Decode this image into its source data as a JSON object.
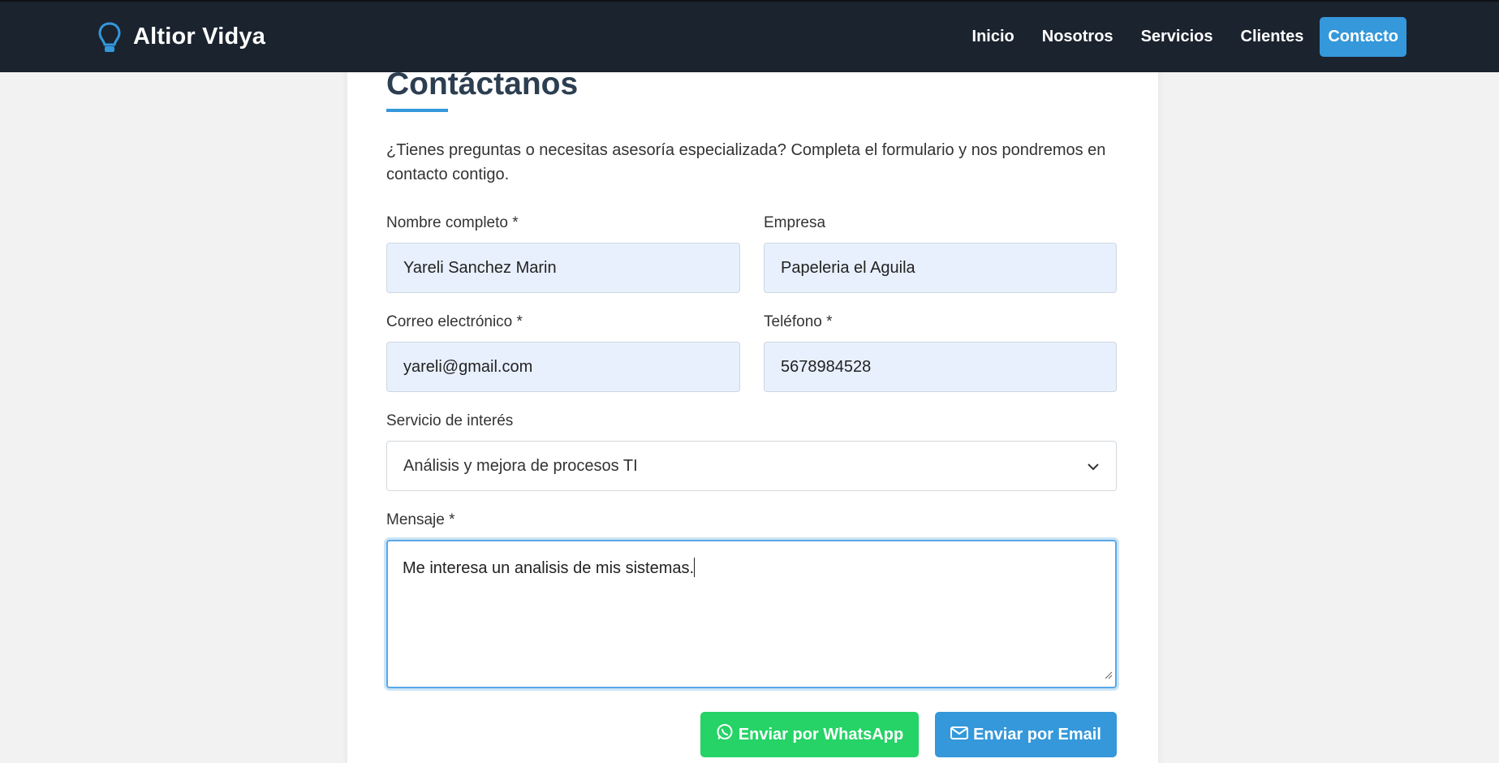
{
  "nav": {
    "brand": "Altior Vidya",
    "brand_icon": "lightbulb-icon",
    "links": [
      "Inicio",
      "Nosotros",
      "Servicios",
      "Clientes",
      "Contacto"
    ],
    "active": "Contacto"
  },
  "colors": {
    "navbar": "#1b232f",
    "accent": "#3498db",
    "whatsapp": "#25d366",
    "title": "#2c3e50"
  },
  "form": {
    "title": "Contáctanos",
    "intro": "¿Tienes preguntas o necesitas asesoría especializada? Completa el formulario y nos pondremos en contacto contigo.",
    "name_label": "Nombre completo *",
    "name_value": "Yareli Sanchez Marin",
    "company_label": "Empresa",
    "company_value": "Papeleria el Aguila",
    "email_label": "Correo electrónico *",
    "email_value": "yareli@gmail.com",
    "phone_label": "Teléfono *",
    "phone_value": "5678984528",
    "service_label": "Servicio de interés",
    "service_value": "Análisis y mejora de procesos TI",
    "message_label": "Mensaje *",
    "message_value": "Me interesa un analisis de mis sistemas.",
    "whatsapp_button": "Enviar por WhatsApp",
    "email_button": "Enviar por Email"
  }
}
